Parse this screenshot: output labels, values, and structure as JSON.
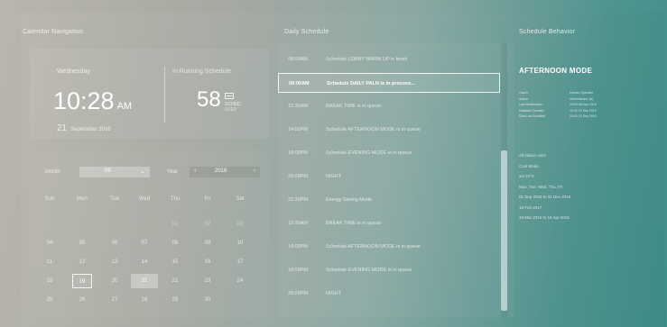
{
  "sections": {
    "calendar_nav": "Calendar Navigation",
    "daily_schedule": "Daily Schedule",
    "schedule_behavior": "Schedule Behavior"
  },
  "clock": {
    "weekday": "Wednesday",
    "time": "10:28",
    "ampm": "AM",
    "day": "21",
    "month_year": "September 2016"
  },
  "running": {
    "label": "In Running Schedule",
    "count": "58",
    "unit1": "SCHED",
    "unit2": "ULES"
  },
  "calendar": {
    "month_label": "Month",
    "month_value": "09",
    "year_label": "Year",
    "year_value": "2016",
    "weekdays": [
      "Sun",
      "Mon",
      "Tue",
      "Wed",
      "Thu",
      "Fri",
      "Sat"
    ],
    "weeks": [
      [
        "",
        "",
        "",
        "",
        "01",
        "02",
        "03"
      ],
      [
        "04",
        "05",
        "06",
        "07",
        "08",
        "09",
        "10"
      ],
      [
        "11",
        "12",
        "13",
        "14",
        "15",
        "16",
        "17"
      ],
      [
        "18",
        "19",
        "20",
        "21",
        "22",
        "23",
        "24"
      ],
      [
        "25",
        "26",
        "27",
        "28",
        "29",
        "30",
        ""
      ]
    ],
    "today": "19",
    "selected": "21"
  },
  "schedule": {
    "items": [
      {
        "time": "08:00AM",
        "text": "Schedule LOBBY WARM UP is finish"
      },
      {
        "time": "09:00AM",
        "text": "Schedule DAILY PALN is in process..."
      },
      {
        "time": "12:30AM",
        "text": "BREAK TIME is in queue"
      },
      {
        "time": "14:00PM",
        "text": "Schedule AFTERNOON MODE is in queue"
      },
      {
        "time": "18:00PM",
        "text": "Schedule EVENING MODE is in queue"
      },
      {
        "time": "20:00PM",
        "text": "NIGHT"
      },
      {
        "time": "22:30PM",
        "text": "Energy Saving Mode"
      },
      {
        "time": "12:30AM",
        "text": "BREAK TIME is in queue"
      },
      {
        "time": "14:00PM",
        "text": "Schedule AFTERNOON MODE is in queue"
      },
      {
        "time": "18:00PM",
        "text": "Schedule EVENING MODE is in queue"
      },
      {
        "time": "20:00PM",
        "text": "NIGHT"
      }
    ],
    "active_index": 1
  },
  "behavior": {
    "mode_title": "AFTERNOON MODE",
    "details": [
      {
        "key": "Owner",
        "value": "Human Operator"
      },
      {
        "key": "Author",
        "value": "Administrator (N)"
      },
      {
        "key": "Last Modification",
        "value": "09:00 AM Apr 2016"
      },
      {
        "key": "Datetime Created",
        "value": "10:20 18 Sep 2016"
      },
      {
        "key": "Date Last Modified",
        "value": "20:00 15 Sep 2016"
      }
    ],
    "lines": [
      "All Indoor units",
      "Cool Mode",
      "set 24°C",
      "Mon, Tue, Wed, Thu, Fri",
      "01 Sep 2016 to 31 Dec 2016",
      "15 Feb 2017",
      "23 Mar 2016 to 18 Apr 2016"
    ]
  }
}
